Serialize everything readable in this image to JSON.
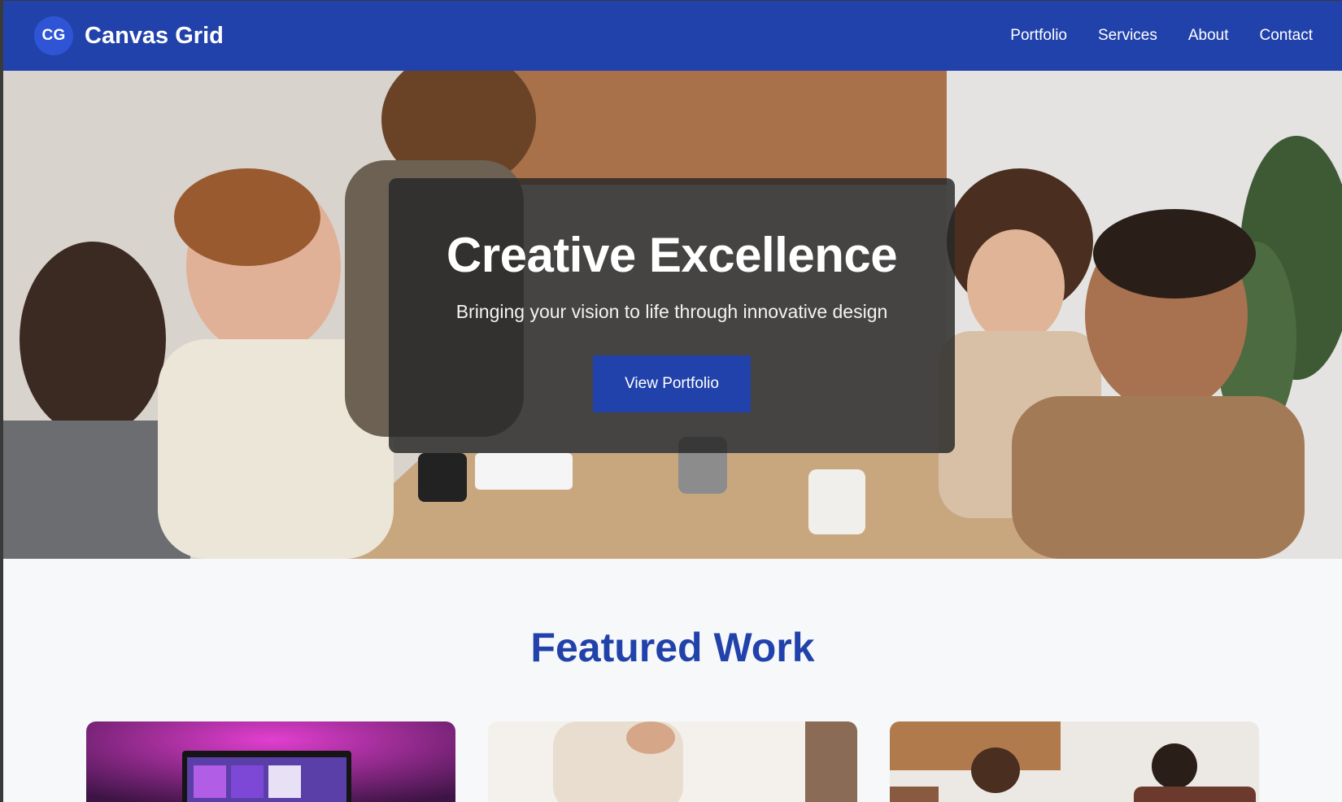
{
  "header": {
    "logo_text": "CG",
    "brand": "Canvas Grid",
    "nav": [
      "Portfolio",
      "Services",
      "About",
      "Contact"
    ]
  },
  "hero": {
    "title": "Creative Excellence",
    "subtitle": "Bringing your vision to life through innovative design",
    "cta": "View Portfolio"
  },
  "featured": {
    "title": "Featured Work"
  },
  "colors": {
    "brand_blue": "#2242ab",
    "logo_blue": "#2f55d6",
    "page_bg": "#f7f8fa"
  }
}
